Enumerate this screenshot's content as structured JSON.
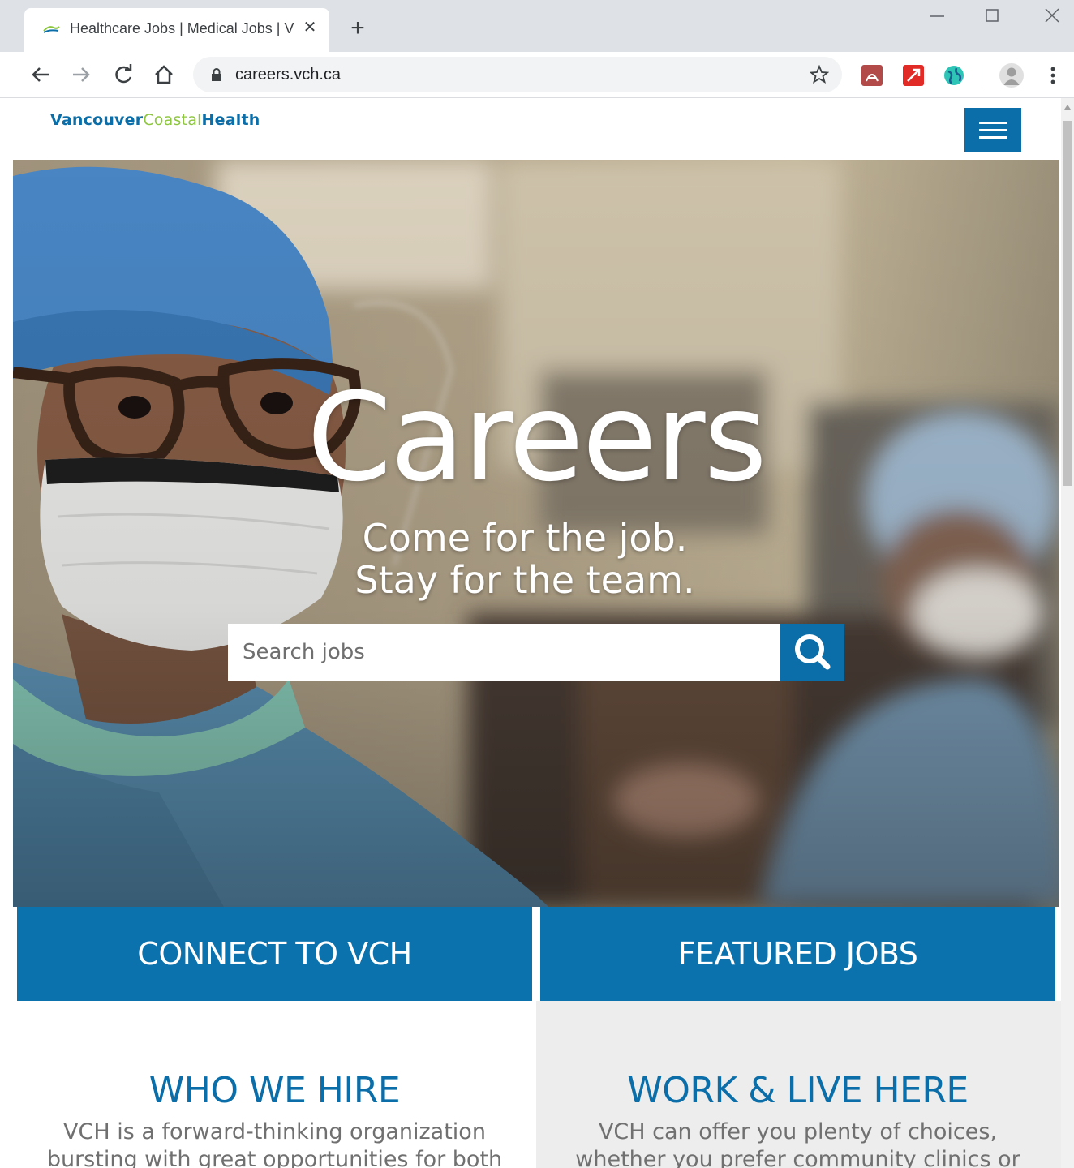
{
  "browser": {
    "tab_title": "Healthcare Jobs | Medical Jobs | V",
    "url": "careers.vch.ca"
  },
  "site": {
    "logo": {
      "part1": "Vancouver",
      "part2": "Coastal",
      "part3": "Health"
    }
  },
  "hero": {
    "title": "Careers",
    "subtitle_line1": "Come for the job.",
    "subtitle_line2": "Stay for the team.",
    "search_placeholder": "Search jobs"
  },
  "cta": {
    "left": "CONNECT TO VCH",
    "right": "FEATURED JOBS"
  },
  "sections": {
    "who": {
      "title": "WHO WE HIRE",
      "text": "VCH is a forward-thinking organization bursting with great opportunities for both new and experienced"
    },
    "work": {
      "title": "WORK & LIVE HERE",
      "text": "VCH can offer you plenty of choices, whether you prefer community clinics or hospital settings, large"
    }
  },
  "colors": {
    "brand_blue": "#0b6ea8",
    "brand_green": "#8dc63f"
  }
}
